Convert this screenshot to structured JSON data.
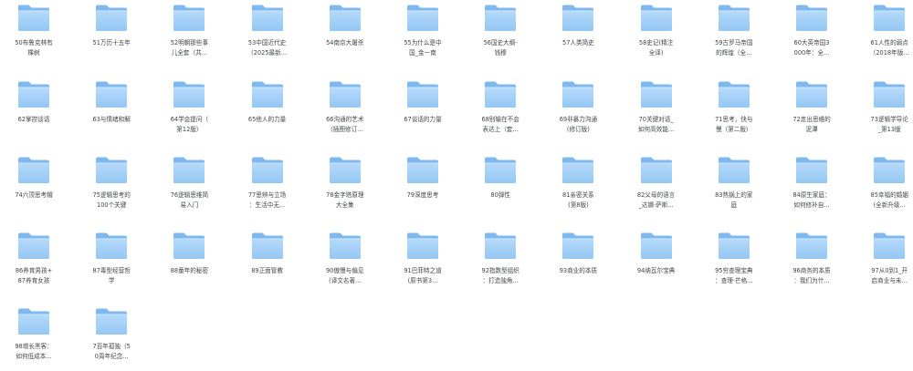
{
  "folder_icon": "folder-icon",
  "colors": {
    "folder_back": "#7eb8ee",
    "folder_front_top": "#b6dafa",
    "folder_front_bottom": "#94c7f3",
    "label_text": "#404448"
  },
  "folders": [
    {
      "label": "50布鲁克林有\n棵树"
    },
    {
      "label": "51万历十五年"
    },
    {
      "label": "52明朝那些事\n儿全套（共..."
    },
    {
      "label": "53中国近代史\n（2025最新..."
    },
    {
      "label": "54南京大屠杀"
    },
    {
      "label": "55为什么是中\n国_金一南"
    },
    {
      "label": "56国史大纲-\n钱穆"
    },
    {
      "label": "57人类简史"
    },
    {
      "label": "58史记(精注\n全译)"
    },
    {
      "label": "59古罗马帝国\n的辉煌（全..."
    },
    {
      "label": "60大英帝国3\n000年：全..."
    },
    {
      "label": "61人性的弱点\n（2018年版..."
    },
    {
      "label": "62掌控谈话"
    },
    {
      "label": "63与情绪和解"
    },
    {
      "label": "64学会提问（\n第12版）"
    },
    {
      "label": "65他人的力量"
    },
    {
      "label": "66沟通的艺术\n（插图修订..."
    },
    {
      "label": "67谈话的力量"
    },
    {
      "label": "68别输在不会\n表达上（套..."
    },
    {
      "label": "69非暴力沟通\n(修订版)"
    },
    {
      "label": "70关键对话_\n如何高效能..."
    },
    {
      "label": "71思考，快与\n慢（第二版）"
    },
    {
      "label": "72走出思维的\n泥潭"
    },
    {
      "label": "73逻辑学导论\n_第13版"
    },
    {
      "label": "74六顶思考帽"
    },
    {
      "label": "75逻辑思考的\n100个关键"
    },
    {
      "label": "76逻辑思维简\n易入门"
    },
    {
      "label": "77思辨与立场\n：生活中无..."
    },
    {
      "label": "78金字塔原理\n大全集"
    },
    {
      "label": "79深度思考"
    },
    {
      "label": "80弹性"
    },
    {
      "label": "81亲密关系\n(第8版)"
    },
    {
      "label": "82父母的语言\n_达娜·萨斯..."
    },
    {
      "label": "83热锅上的家\n庭"
    },
    {
      "label": "84原生家庭：\n如何修补自..."
    },
    {
      "label": "85幸福的婚姻\n(全新升级..."
    },
    {
      "label": "86养育男孩+\n87养育女孩"
    },
    {
      "label": "87毒型经营哲\n学"
    },
    {
      "label": "88童年的秘密"
    },
    {
      "label": "89正面管教"
    },
    {
      "label": "90傲慢与偏见\n(译文名著..."
    },
    {
      "label": "91巴菲特之道\n(原书第3..."
    },
    {
      "label": "92指数型组织\n：打造独角..."
    },
    {
      "label": "93商业的本质"
    },
    {
      "label": "94纳瓦尔宝典"
    },
    {
      "label": "95穷查理宝典\n：查理·芒格..."
    },
    {
      "label": "96商务的本质\n：我们为什..."
    },
    {
      "label": "97从0到1_开\n启商业与未..."
    },
    {
      "label": "98增长黑客：\n如何低成本..."
    },
    {
      "label": "7百年孤独（5\n0周年纪念..."
    }
  ]
}
